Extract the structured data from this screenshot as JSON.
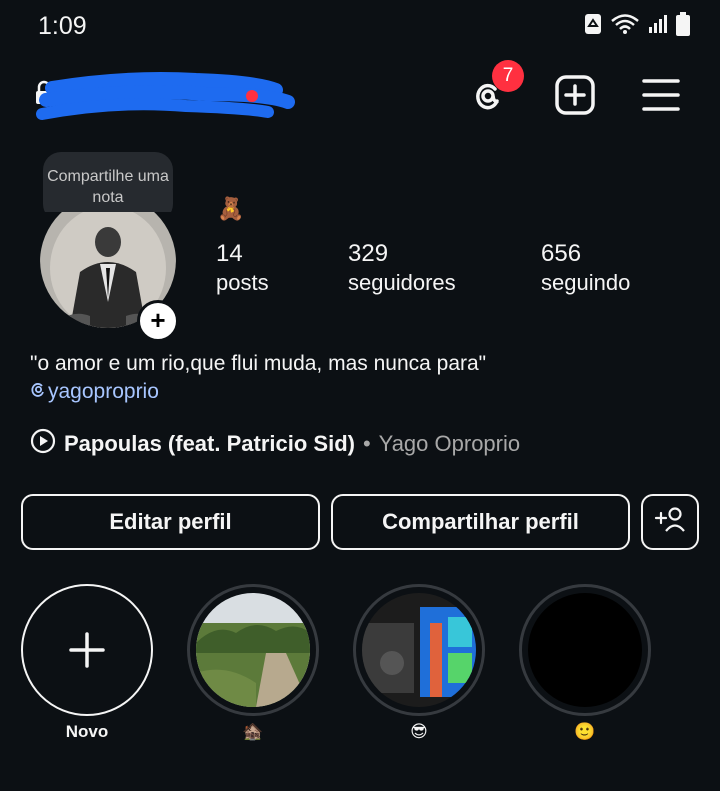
{
  "status_bar": {
    "time": "1:09"
  },
  "header": {
    "username": "bi"
  },
  "notifications": {
    "threads_badge": "7"
  },
  "note": {
    "text": "Compartilhe uma nota"
  },
  "profile": {
    "emoji": "🧸",
    "stats": [
      {
        "value": "14",
        "label": "posts"
      },
      {
        "value": "329",
        "label": "seguidores"
      },
      {
        "value": "656",
        "label": "seguindo"
      }
    ],
    "bio": "\"o amor e um rio,que flui muda, mas nunca para\"",
    "threads_handle": "yagoproprio",
    "music": {
      "song": "Papoulas (feat. Patricio Sid)",
      "separator": "•",
      "artist": "Yago Oproprio"
    }
  },
  "actions": {
    "edit_label": "Editar perfil",
    "share_label": "Compartilhar perfil"
  },
  "highlights": [
    {
      "label": "Novo"
    },
    {
      "label": "🏚️"
    },
    {
      "label": "😎"
    },
    {
      "label": "🙂"
    }
  ],
  "colors": {
    "background": "#0c1014",
    "badge": "#ff3040",
    "link": "#a8c6ff",
    "muted": "#a8a8a8"
  }
}
